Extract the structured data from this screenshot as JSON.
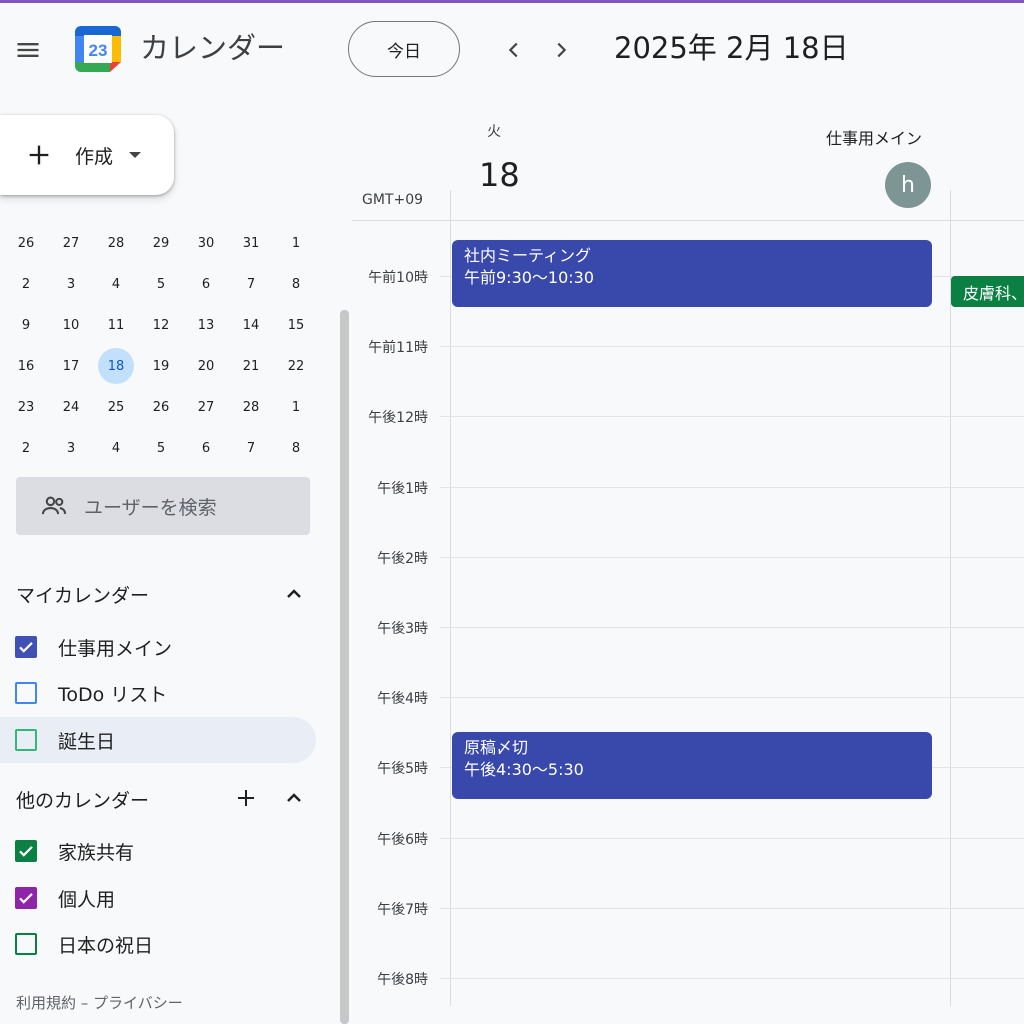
{
  "header": {
    "app_name": "カレンダー",
    "logo_number": "23",
    "today_label": "今日",
    "date_title": "2025年 2月 18日"
  },
  "create": {
    "label": "作成"
  },
  "mini_calendar": {
    "weeks": [
      [
        "26",
        "27",
        "28",
        "29",
        "30",
        "31",
        "1"
      ],
      [
        "2",
        "3",
        "4",
        "5",
        "6",
        "7",
        "8"
      ],
      [
        "9",
        "10",
        "11",
        "12",
        "13",
        "14",
        "15"
      ],
      [
        "16",
        "17",
        "18",
        "19",
        "20",
        "21",
        "22"
      ],
      [
        "23",
        "24",
        "25",
        "26",
        "27",
        "28",
        "1"
      ],
      [
        "2",
        "3",
        "4",
        "5",
        "6",
        "7",
        "8"
      ]
    ],
    "selected_day": "18"
  },
  "user_search": {
    "placeholder": "ユーザーを検索"
  },
  "my_calendars": {
    "title": "マイカレンダー",
    "items": [
      {
        "label": "仕事用メイン",
        "checked": true,
        "color": "#3f51b5"
      },
      {
        "label": "ToDo リスト",
        "checked": false,
        "color": "#4285f4"
      },
      {
        "label": "誕生日",
        "checked": false,
        "color": "#33b679"
      }
    ]
  },
  "other_calendars": {
    "title": "他のカレンダー",
    "items": [
      {
        "label": "家族共有",
        "checked": true,
        "color": "#0b8043"
      },
      {
        "label": "個人用",
        "checked": true,
        "color": "#8e24aa"
      },
      {
        "label": "日本の祝日",
        "checked": false,
        "color": "#0b8043"
      }
    ]
  },
  "footer": {
    "text": "利用規約 – プライバシー"
  },
  "day_view": {
    "day_name": "火",
    "day_number": "18",
    "calendar_column_title": "仕事用メイン",
    "avatar_letter": "h",
    "timezone": "GMT+09",
    "hours": [
      "午前10時",
      "午前11時",
      "午後12時",
      "午後1時",
      "午後2時",
      "午後3時",
      "午後4時",
      "午後5時",
      "午後6時",
      "午後7時",
      "午後8時"
    ],
    "events": [
      {
        "title": "社内ミーティング",
        "time": "午前9:30～10:30",
        "color": "#3949ab"
      },
      {
        "title": "原稿〆切",
        "time": "午後4:30～5:30",
        "color": "#3949ab"
      }
    ],
    "side_event": {
      "title": "皮膚科、",
      "color": "#0b8043"
    }
  }
}
